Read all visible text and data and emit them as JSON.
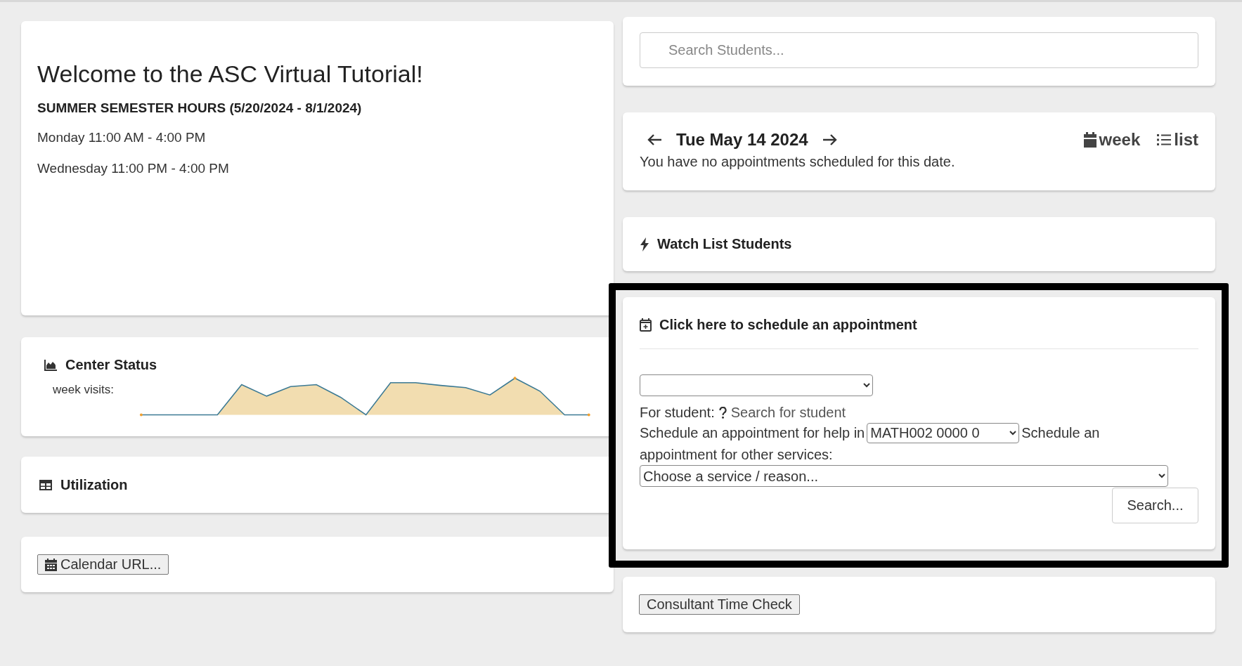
{
  "welcome": {
    "title": "Welcome to the ASC Virtual Tutorial!",
    "subtitle": "SUMMER SEMESTER HOURS (5/20/2024 - 8/1/2024)",
    "hours": [
      "Monday 11:00 AM - 4:00 PM",
      "Wednesday 11:00 PM - 4:00 PM"
    ]
  },
  "center_status": {
    "title": "Center Status",
    "label": "week visits:"
  },
  "utilization": {
    "title": "Utilization"
  },
  "calendar_button": "Calendar URL...",
  "search": {
    "placeholder": "Search Students..."
  },
  "day_view": {
    "date": "Tue May 14 2024",
    "message": "You have no appointments scheduled for this date.",
    "views": [
      {
        "kind": "calendar",
        "label": "week"
      },
      {
        "kind": "list",
        "label": "list"
      }
    ]
  },
  "watch_list": {
    "title": "Watch List Students"
  },
  "schedule": {
    "title": "Click here to schedule an appointment",
    "for_label": "For student:",
    "student_link": "Search for student",
    "help_label": "Schedule an appointment for help in",
    "course_select": "MATH002 0000 0",
    "other_label_lines": [
      "Schedule an",
      "appointment for other services:"
    ],
    "service_select": "Choose a service / reason...",
    "search_button": "Search..."
  },
  "consultant_button": "Consultant Time Check"
}
